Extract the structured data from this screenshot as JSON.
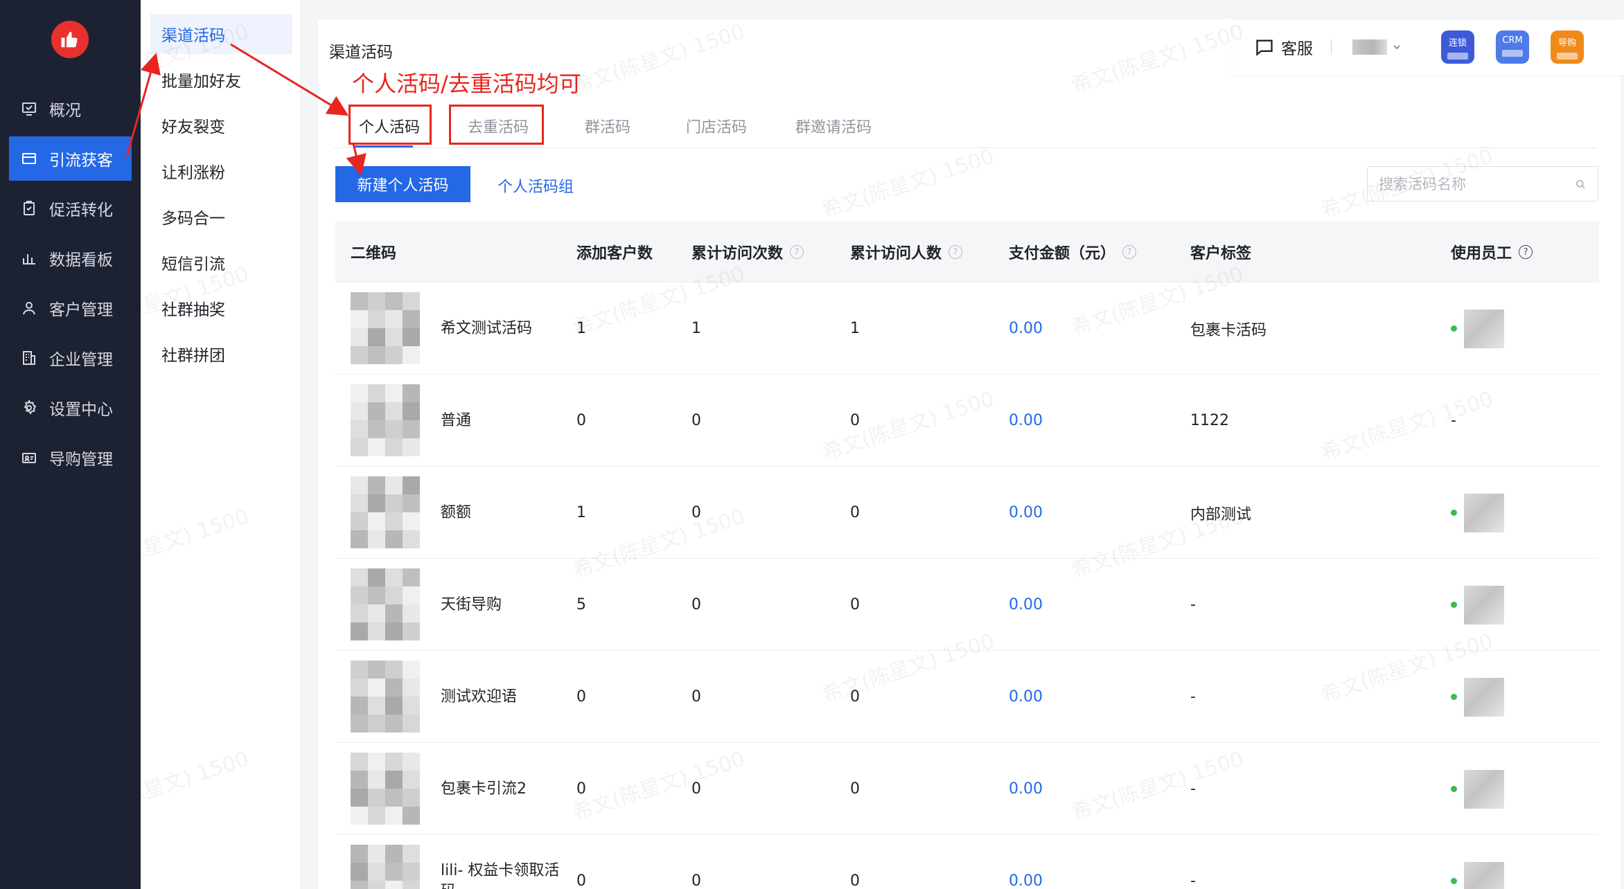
{
  "sidebar": {
    "items": [
      {
        "label": "概况",
        "icon": "overview-icon"
      },
      {
        "label": "引流获客",
        "icon": "acquire-icon"
      },
      {
        "label": "促活转化",
        "icon": "convert-icon"
      },
      {
        "label": "数据看板",
        "icon": "chart-icon"
      },
      {
        "label": "客户管理",
        "icon": "user-icon"
      },
      {
        "label": "企业管理",
        "icon": "building-icon"
      },
      {
        "label": "设置中心",
        "icon": "gear-icon"
      },
      {
        "label": "导购管理",
        "icon": "badge-icon"
      }
    ],
    "active_index": 1
  },
  "submenu": {
    "items": [
      "渠道活码",
      "批量加好友",
      "好友裂变",
      "让利涨粉",
      "多码合一",
      "短信引流",
      "社群抽奖",
      "社群拼团"
    ],
    "active_index": 0
  },
  "breadcrumb": "渠道活码",
  "topbar": {
    "support_label": "客服",
    "apps": [
      {
        "label": "连锁",
        "color": "#3d5bd9"
      },
      {
        "label": "CRM",
        "color": "#4f7be8"
      },
      {
        "label": "导购",
        "color": "#f08a1c"
      }
    ]
  },
  "annotation": "个人活码/去重活码均可",
  "tabs": [
    "个人活码",
    "去重活码",
    "群活码",
    "门店活码",
    "群邀请活码"
  ],
  "active_tab": 0,
  "actions": {
    "new_button": "新建个人活码",
    "group_link": "个人活码组",
    "search_placeholder": "搜索活码名称"
  },
  "table": {
    "columns": [
      "二维码",
      "添加客户数",
      "累计访问次数",
      "累计访问人数",
      "支付金额（元）",
      "客户标签",
      "使用员工"
    ],
    "rows": [
      {
        "name": "希文测试活码",
        "added": "1",
        "visits": "1",
        "visitors": "1",
        "amount": "0.00",
        "tag": "包裹卡活码",
        "employee": true
      },
      {
        "name": "普通",
        "added": "0",
        "visits": "0",
        "visitors": "0",
        "amount": "0.00",
        "tag": "1122",
        "employee": false
      },
      {
        "name": "额额",
        "added": "1",
        "visits": "0",
        "visitors": "0",
        "amount": "0.00",
        "tag": "内部测试",
        "employee": true
      },
      {
        "name": "天街导购",
        "added": "5",
        "visits": "0",
        "visitors": "0",
        "amount": "0.00",
        "tag": "-",
        "employee": true
      },
      {
        "name": "测试欢迎语",
        "added": "0",
        "visits": "0",
        "visitors": "0",
        "amount": "0.00",
        "tag": "-",
        "employee": true
      },
      {
        "name": "包裹卡引流2",
        "added": "0",
        "visits": "0",
        "visitors": "0",
        "amount": "0.00",
        "tag": "-",
        "employee": true
      },
      {
        "name": "lili- 权益卡领取活码",
        "added": "0",
        "visits": "0",
        "visitors": "0",
        "amount": "0.00",
        "tag": "-",
        "employee": true
      }
    ],
    "empty_employee": "-"
  },
  "watermark": "希文(陈星文) 1500"
}
